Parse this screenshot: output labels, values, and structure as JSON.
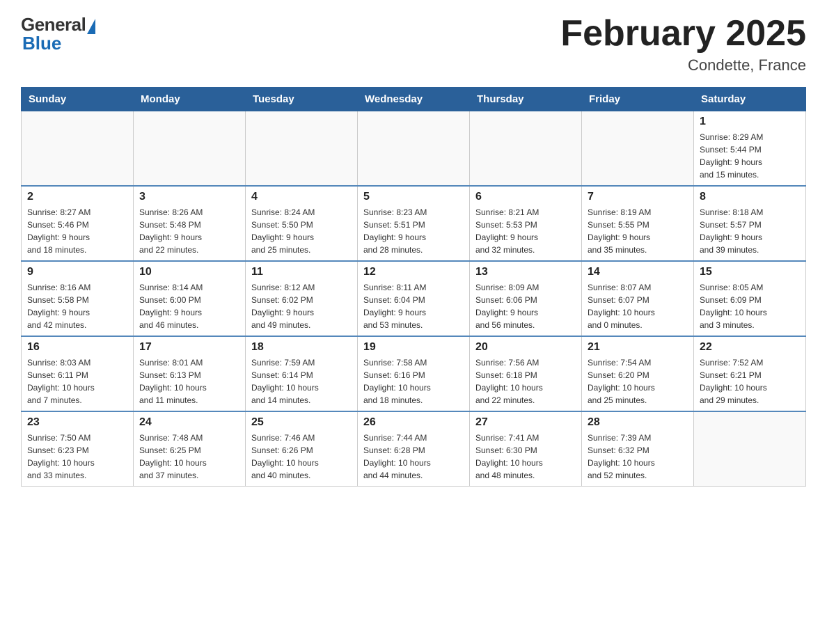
{
  "header": {
    "title": "February 2025",
    "subtitle": "Condette, France",
    "logo_general": "General",
    "logo_blue": "Blue"
  },
  "calendar": {
    "days_of_week": [
      "Sunday",
      "Monday",
      "Tuesday",
      "Wednesday",
      "Thursday",
      "Friday",
      "Saturday"
    ],
    "weeks": [
      [
        {
          "day": "",
          "info": ""
        },
        {
          "day": "",
          "info": ""
        },
        {
          "day": "",
          "info": ""
        },
        {
          "day": "",
          "info": ""
        },
        {
          "day": "",
          "info": ""
        },
        {
          "day": "",
          "info": ""
        },
        {
          "day": "1",
          "info": "Sunrise: 8:29 AM\nSunset: 5:44 PM\nDaylight: 9 hours\nand 15 minutes."
        }
      ],
      [
        {
          "day": "2",
          "info": "Sunrise: 8:27 AM\nSunset: 5:46 PM\nDaylight: 9 hours\nand 18 minutes."
        },
        {
          "day": "3",
          "info": "Sunrise: 8:26 AM\nSunset: 5:48 PM\nDaylight: 9 hours\nand 22 minutes."
        },
        {
          "day": "4",
          "info": "Sunrise: 8:24 AM\nSunset: 5:50 PM\nDaylight: 9 hours\nand 25 minutes."
        },
        {
          "day": "5",
          "info": "Sunrise: 8:23 AM\nSunset: 5:51 PM\nDaylight: 9 hours\nand 28 minutes."
        },
        {
          "day": "6",
          "info": "Sunrise: 8:21 AM\nSunset: 5:53 PM\nDaylight: 9 hours\nand 32 minutes."
        },
        {
          "day": "7",
          "info": "Sunrise: 8:19 AM\nSunset: 5:55 PM\nDaylight: 9 hours\nand 35 minutes."
        },
        {
          "day": "8",
          "info": "Sunrise: 8:18 AM\nSunset: 5:57 PM\nDaylight: 9 hours\nand 39 minutes."
        }
      ],
      [
        {
          "day": "9",
          "info": "Sunrise: 8:16 AM\nSunset: 5:58 PM\nDaylight: 9 hours\nand 42 minutes."
        },
        {
          "day": "10",
          "info": "Sunrise: 8:14 AM\nSunset: 6:00 PM\nDaylight: 9 hours\nand 46 minutes."
        },
        {
          "day": "11",
          "info": "Sunrise: 8:12 AM\nSunset: 6:02 PM\nDaylight: 9 hours\nand 49 minutes."
        },
        {
          "day": "12",
          "info": "Sunrise: 8:11 AM\nSunset: 6:04 PM\nDaylight: 9 hours\nand 53 minutes."
        },
        {
          "day": "13",
          "info": "Sunrise: 8:09 AM\nSunset: 6:06 PM\nDaylight: 9 hours\nand 56 minutes."
        },
        {
          "day": "14",
          "info": "Sunrise: 8:07 AM\nSunset: 6:07 PM\nDaylight: 10 hours\nand 0 minutes."
        },
        {
          "day": "15",
          "info": "Sunrise: 8:05 AM\nSunset: 6:09 PM\nDaylight: 10 hours\nand 3 minutes."
        }
      ],
      [
        {
          "day": "16",
          "info": "Sunrise: 8:03 AM\nSunset: 6:11 PM\nDaylight: 10 hours\nand 7 minutes."
        },
        {
          "day": "17",
          "info": "Sunrise: 8:01 AM\nSunset: 6:13 PM\nDaylight: 10 hours\nand 11 minutes."
        },
        {
          "day": "18",
          "info": "Sunrise: 7:59 AM\nSunset: 6:14 PM\nDaylight: 10 hours\nand 14 minutes."
        },
        {
          "day": "19",
          "info": "Sunrise: 7:58 AM\nSunset: 6:16 PM\nDaylight: 10 hours\nand 18 minutes."
        },
        {
          "day": "20",
          "info": "Sunrise: 7:56 AM\nSunset: 6:18 PM\nDaylight: 10 hours\nand 22 minutes."
        },
        {
          "day": "21",
          "info": "Sunrise: 7:54 AM\nSunset: 6:20 PM\nDaylight: 10 hours\nand 25 minutes."
        },
        {
          "day": "22",
          "info": "Sunrise: 7:52 AM\nSunset: 6:21 PM\nDaylight: 10 hours\nand 29 minutes."
        }
      ],
      [
        {
          "day": "23",
          "info": "Sunrise: 7:50 AM\nSunset: 6:23 PM\nDaylight: 10 hours\nand 33 minutes."
        },
        {
          "day": "24",
          "info": "Sunrise: 7:48 AM\nSunset: 6:25 PM\nDaylight: 10 hours\nand 37 minutes."
        },
        {
          "day": "25",
          "info": "Sunrise: 7:46 AM\nSunset: 6:26 PM\nDaylight: 10 hours\nand 40 minutes."
        },
        {
          "day": "26",
          "info": "Sunrise: 7:44 AM\nSunset: 6:28 PM\nDaylight: 10 hours\nand 44 minutes."
        },
        {
          "day": "27",
          "info": "Sunrise: 7:41 AM\nSunset: 6:30 PM\nDaylight: 10 hours\nand 48 minutes."
        },
        {
          "day": "28",
          "info": "Sunrise: 7:39 AM\nSunset: 6:32 PM\nDaylight: 10 hours\nand 52 minutes."
        },
        {
          "day": "",
          "info": ""
        }
      ]
    ]
  }
}
